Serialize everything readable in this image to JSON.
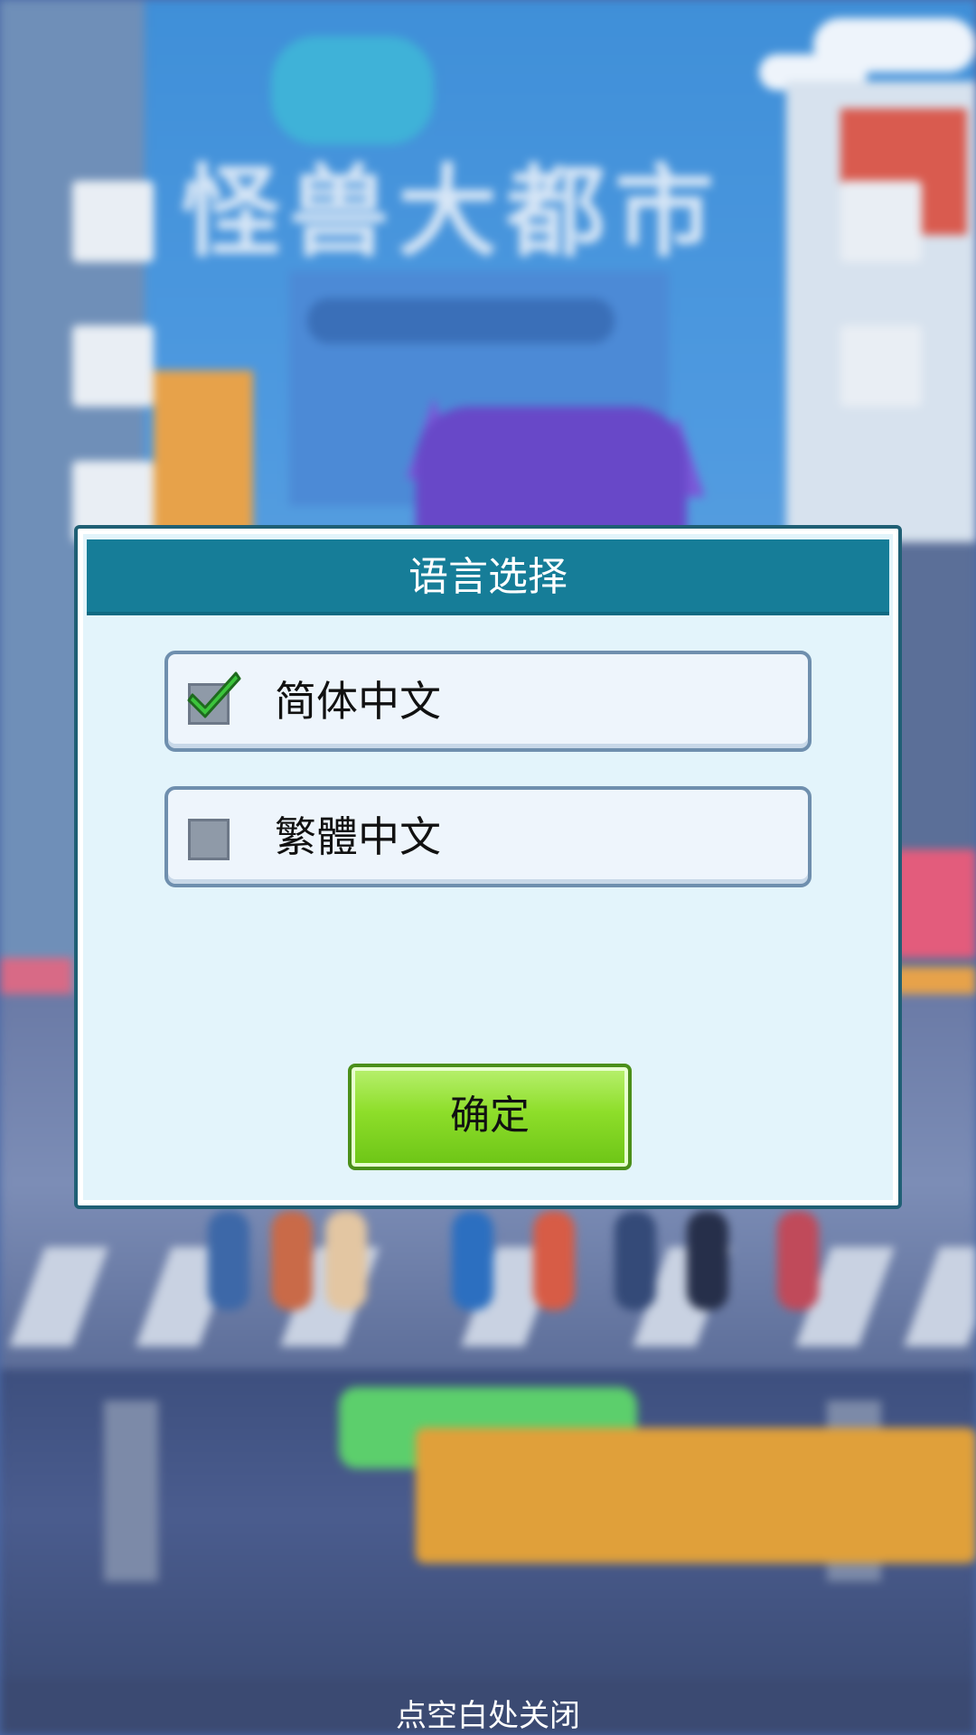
{
  "game": {
    "logo_text": "怪兽大都市"
  },
  "dialog": {
    "title": "语言选择",
    "options": [
      {
        "label": "简体中文",
        "checked": true
      },
      {
        "label": "繁體中文",
        "checked": false
      }
    ],
    "confirm_label": "确定"
  },
  "footer": {
    "close_hint": "点空白处关闭"
  },
  "colors": {
    "title_bar": "#167d98",
    "dialog_bg": "#e3f4fb",
    "confirm_green": "#8ede2a",
    "checkmark_green": "#3cc43c"
  }
}
